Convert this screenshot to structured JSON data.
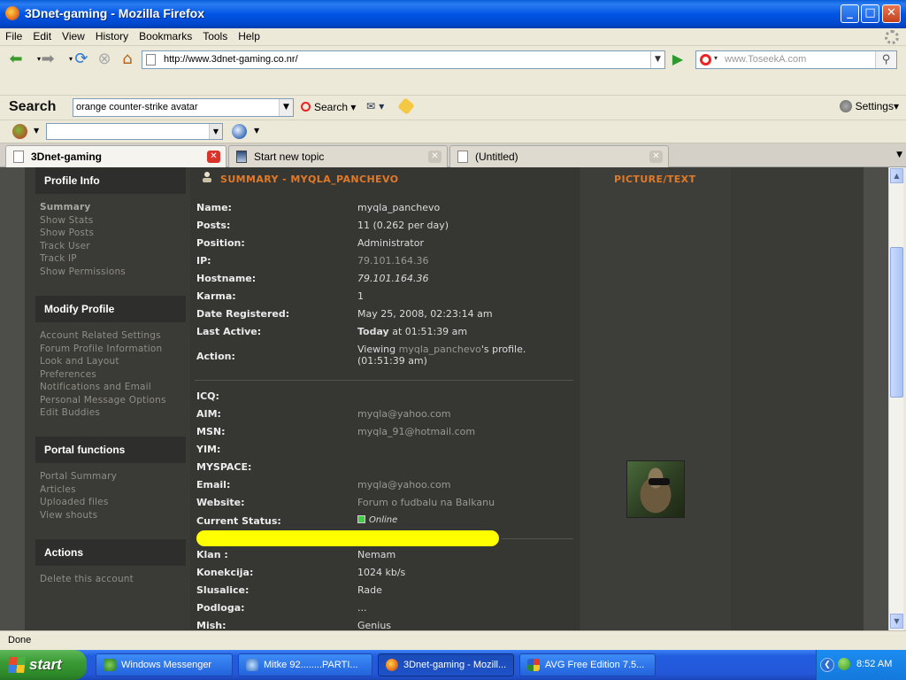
{
  "window": {
    "title": "3Dnet-gaming - Mozilla Firefox"
  },
  "menu": [
    "File",
    "Edit",
    "View",
    "History",
    "Bookmarks",
    "Tools",
    "Help"
  ],
  "nav": {
    "url": "http://www.3dnet-gaming.co.nr/",
    "search_placeholder": "www.ToseekA.com"
  },
  "search_toolbar": {
    "label": "Search",
    "query": "orange counter-strike avatar",
    "search_button": "Search",
    "settings": "Settings"
  },
  "tabs": [
    {
      "label": "3Dnet-gaming"
    },
    {
      "label": "Start new topic"
    },
    {
      "label": "(Untitled)"
    }
  ],
  "sidebar": [
    {
      "title": "Profile Info",
      "items": [
        "Summary",
        "Show Stats",
        "Show Posts",
        "Track User",
        "Track IP",
        "Show Permissions"
      ]
    },
    {
      "title": "Modify Profile",
      "items": [
        "Account Related Settings",
        "Forum Profile Information",
        "Look and Layout Preferences",
        "Notifications and Email",
        "Personal Message Options",
        "Edit Buddies"
      ]
    },
    {
      "title": "Portal functions",
      "items": [
        "Portal Summary",
        "Articles",
        "Uploaded files",
        "View shouts"
      ]
    },
    {
      "title": "Actions",
      "items": [
        "Delete this account"
      ]
    }
  ],
  "summary": {
    "title": "SUMMARY - MYQLA_PANCHEVO",
    "picture_title": "PICTURE/TEXT",
    "rows": [
      {
        "label": "Name:",
        "value": "myqla_panchevo"
      },
      {
        "label": "Posts:",
        "value": "11 (0.262 per day)"
      },
      {
        "label": "Position:",
        "value": "Administrator"
      },
      {
        "label": "IP:",
        "value": "79.101.164.36"
      },
      {
        "label": "Hostname:",
        "value": "79.101.164.36"
      },
      {
        "label": "Karma:",
        "value": "1"
      },
      {
        "label": "Date Registered:",
        "value": "May 25, 2008, 02:23:14 am"
      },
      {
        "label": "Last Active:",
        "value_bold": "Today",
        "value": " at 01:51:39 am"
      },
      {
        "label": "Action:",
        "value_pre": "Viewing ",
        "value_link": "myqla_panchevo",
        "value_post": "'s profile.",
        "value_line2": "(01:51:39 am)"
      }
    ],
    "contacts": [
      {
        "label": "ICQ:",
        "value": ""
      },
      {
        "label": "AIM:",
        "value": "myqla@yahoo.com"
      },
      {
        "label": "MSN:",
        "value": "myqla_91@hotmail.com"
      },
      {
        "label": "YIM:",
        "value": ""
      },
      {
        "label": "MYSPACE:",
        "value": ""
      },
      {
        "label": "Email:",
        "value": "myqla@yahoo.com"
      },
      {
        "label": "Website:",
        "value": "Forum o fudbalu na Balkanu"
      },
      {
        "label": "Current Status:",
        "value": "Online"
      }
    ],
    "extra": [
      {
        "label": "Klan :",
        "value": "Nemam"
      },
      {
        "label": "Konekcija:",
        "value": "1024 kb/s"
      },
      {
        "label": "Slusalice:",
        "value": "Rade"
      },
      {
        "label": "Podloga:",
        "value": "..."
      },
      {
        "label": "Mish:",
        "value": "Genius"
      }
    ]
  },
  "status": "Done",
  "taskbar": {
    "start": "start",
    "tasks": [
      {
        "label": "Windows Messenger"
      },
      {
        "label": "Mitke 92........PARTI..."
      },
      {
        "label": "3Dnet-gaming - Mozill..."
      },
      {
        "label": "AVG Free Edition  7.5..."
      }
    ],
    "clock": "8:52 AM"
  },
  "colors": {
    "accent_orange": "#e07a28",
    "highlight_yellow": "#ffff00",
    "online_green": "#3fcf3f"
  }
}
